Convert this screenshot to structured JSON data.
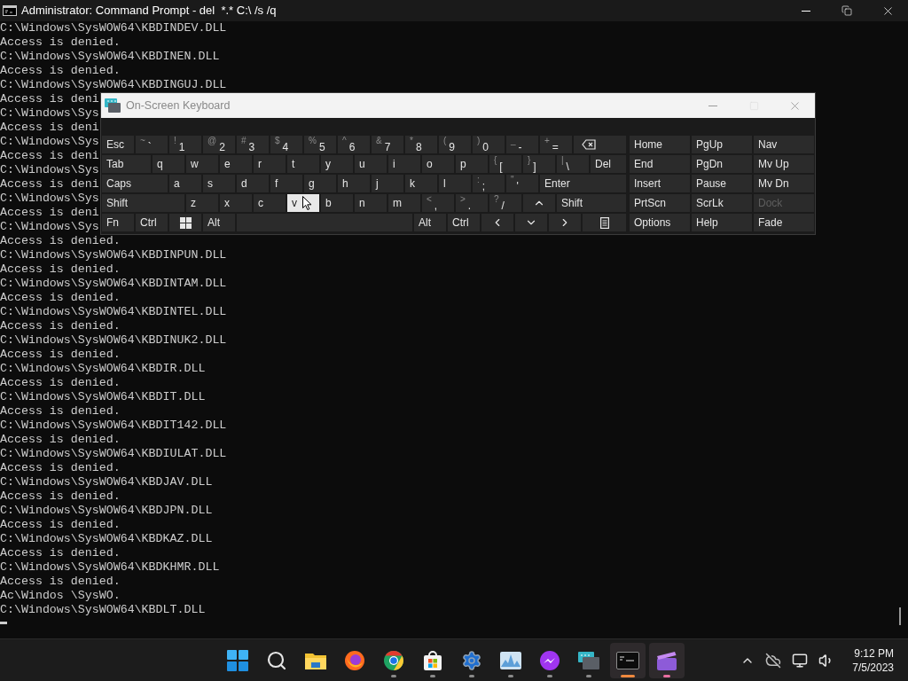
{
  "console": {
    "title": "Administrator: Command Prompt - del  *.* C:\\ /s /q",
    "lines": [
      "C:\\Windows\\SysWOW64\\KBDINDEV.DLL",
      "Access is denied.",
      "C:\\Windows\\SysWOW64\\KBDINEN.DLL",
      "Access is denied.",
      "C:\\Windows\\SysWOW64\\KBDINGUJ.DLL",
      "Access is deni",
      "C:\\Windows\\Sys",
      "Access is deni",
      "C:\\Windows\\Sys",
      "Access is deni",
      "C:\\Windows\\Sys",
      "Access is deni",
      "C:\\Windows\\Sys",
      "Access is deni",
      "C:\\Windows\\Sys",
      "Access is denied.",
      "C:\\Windows\\SysWOW64\\KBDINPUN.DLL",
      "Access is denied.",
      "C:\\Windows\\SysWOW64\\KBDINTAM.DLL",
      "Access is denied.",
      "C:\\Windows\\SysWOW64\\KBDINTEL.DLL",
      "Access is denied.",
      "C:\\Windows\\SysWOW64\\KBDINUK2.DLL",
      "Access is denied.",
      "C:\\Windows\\SysWOW64\\KBDIR.DLL",
      "Access is denied.",
      "C:\\Windows\\SysWOW64\\KBDIT.DLL",
      "Access is denied.",
      "C:\\Windows\\SysWOW64\\KBDIT142.DLL",
      "Access is denied.",
      "C:\\Windows\\SysWOW64\\KBDIULAT.DLL",
      "Access is denied.",
      "C:\\Windows\\SysWOW64\\KBDJAV.DLL",
      "Access is denied.",
      "C:\\Windows\\SysWOW64\\KBDJPN.DLL",
      "Access is denied.",
      "C:\\Windows\\SysWOW64\\KBDKAZ.DLL",
      "Access is denied.",
      "C:\\Windows\\SysWOW64\\KBDKHMR.DLL",
      "Access is denied.",
      "Ac\\Windos \\SysWO.",
      "C:\\Windows\\SysWOW64\\KBDLT.DLL"
    ]
  },
  "keyboard": {
    "title": "On-Screen Keyboard",
    "rows": [
      {
        "keys": [
          {
            "kind": "char",
            "label": "Esc",
            "hovered": false
          },
          {
            "kind": "char",
            "shift": "~",
            "label": "`",
            "hovered": false
          },
          {
            "kind": "char",
            "shift": "!",
            "label": "1",
            "hovered": false
          },
          {
            "kind": "char",
            "shift": "@",
            "label": "2",
            "hovered": false
          },
          {
            "kind": "char",
            "shift": "#",
            "label": "3",
            "hovered": false
          },
          {
            "kind": "char",
            "shift": "$",
            "label": "4",
            "hovered": false
          },
          {
            "kind": "char",
            "shift": "%",
            "label": "5",
            "hovered": false
          },
          {
            "kind": "char",
            "shift": "^",
            "label": "6",
            "hovered": false
          },
          {
            "kind": "char",
            "shift": "&",
            "label": "7",
            "hovered": false
          },
          {
            "kind": "char",
            "shift": "*",
            "label": "8",
            "hovered": false
          },
          {
            "kind": "char",
            "shift": "(",
            "label": "9",
            "hovered": false
          },
          {
            "kind": "char",
            "shift": ")",
            "label": "0",
            "hovered": false
          },
          {
            "kind": "char",
            "shift": "_",
            "label": "-",
            "hovered": false
          },
          {
            "kind": "char",
            "shift": "+",
            "label": "=",
            "hovered": false
          },
          {
            "kind": "backspace",
            "hovered": false
          }
        ]
      },
      {
        "keys": [
          {
            "kind": "tab",
            "label": "Tab",
            "hovered": false
          },
          {
            "kind": "char",
            "label": "q",
            "hovered": false
          },
          {
            "kind": "char",
            "label": "w",
            "hovered": false
          },
          {
            "kind": "char",
            "label": "e",
            "hovered": false
          },
          {
            "kind": "char",
            "label": "r",
            "hovered": false
          },
          {
            "kind": "char",
            "label": "t",
            "hovered": false
          },
          {
            "kind": "char",
            "label": "y",
            "hovered": false
          },
          {
            "kind": "char",
            "label": "u",
            "hovered": false
          },
          {
            "kind": "char",
            "label": "i",
            "hovered": false
          },
          {
            "kind": "char",
            "label": "o",
            "hovered": false
          },
          {
            "kind": "char",
            "label": "p",
            "hovered": false
          },
          {
            "kind": "char",
            "shift": "{",
            "label": "[",
            "hovered": false
          },
          {
            "kind": "char",
            "shift": "}",
            "label": "]",
            "hovered": false
          },
          {
            "kind": "char",
            "shift": "|",
            "label": "\\",
            "hovered": false
          },
          {
            "kind": "wide",
            "label": "Del",
            "hovered": false
          }
        ]
      },
      {
        "keys": [
          {
            "kind": "caps",
            "label": "Caps",
            "hovered": false
          },
          {
            "kind": "char",
            "label": "a",
            "hovered": false
          },
          {
            "kind": "char",
            "label": "s",
            "hovered": false
          },
          {
            "kind": "char",
            "label": "d",
            "hovered": false
          },
          {
            "kind": "char",
            "label": "f",
            "hovered": false
          },
          {
            "kind": "char",
            "label": "g",
            "hovered": false
          },
          {
            "kind": "char",
            "label": "h",
            "hovered": false
          },
          {
            "kind": "char",
            "label": "j",
            "hovered": false
          },
          {
            "kind": "char",
            "label": "k",
            "hovered": false
          },
          {
            "kind": "char",
            "label": "l",
            "hovered": false
          },
          {
            "kind": "char",
            "shift": ":",
            "label": ";",
            "hovered": false
          },
          {
            "kind": "char",
            "shift": "\"",
            "label": "'",
            "hovered": false
          },
          {
            "kind": "wide",
            "label": "Enter",
            "hovered": false
          }
        ]
      },
      {
        "keys": [
          {
            "kind": "shift",
            "label": "Shift",
            "hovered": false
          },
          {
            "kind": "char",
            "label": "z",
            "hovered": false
          },
          {
            "kind": "char",
            "label": "x",
            "hovered": false
          },
          {
            "kind": "char",
            "label": "c",
            "hovered": false
          },
          {
            "kind": "char",
            "label": "v",
            "hovered": true
          },
          {
            "kind": "char",
            "label": "b",
            "hovered": false
          },
          {
            "kind": "char",
            "label": "n",
            "hovered": false
          },
          {
            "kind": "char",
            "label": "m",
            "hovered": false
          },
          {
            "kind": "char",
            "shift": "<",
            "label": ",",
            "hovered": false
          },
          {
            "kind": "char",
            "shift": ">",
            "label": ".",
            "hovered": false
          },
          {
            "kind": "char",
            "shift": "?",
            "label": "/",
            "hovered": false
          },
          {
            "kind": "up",
            "hovered": false
          },
          {
            "kind": "wide",
            "label": "Shift",
            "hovered": false
          }
        ]
      },
      {
        "keys": [
          {
            "kind": "char",
            "label": "Fn",
            "hovered": false
          },
          {
            "kind": "char",
            "label": "Ctrl",
            "hovered": false
          },
          {
            "kind": "windows",
            "hovered": false
          },
          {
            "kind": "char",
            "label": "Alt",
            "hovered": false
          },
          {
            "kind": "space",
            "hovered": false
          },
          {
            "kind": "char",
            "label": "Alt",
            "hovered": false
          },
          {
            "kind": "char",
            "label": "Ctrl",
            "hovered": false
          },
          {
            "kind": "left",
            "hovered": false
          },
          {
            "kind": "down",
            "hovered": false
          },
          {
            "kind": "right",
            "hovered": false
          },
          {
            "kind": "menu",
            "hovered": false
          }
        ]
      }
    ],
    "nav": [
      {
        "label": "Home",
        "disabled": false
      },
      {
        "label": "PgUp",
        "disabled": false
      },
      {
        "label": "Nav",
        "disabled": false
      },
      {
        "label": "End",
        "disabled": false
      },
      {
        "label": "PgDn",
        "disabled": false
      },
      {
        "label": "Mv Up",
        "disabled": false
      },
      {
        "label": "Insert",
        "disabled": false
      },
      {
        "label": "Pause",
        "disabled": false
      },
      {
        "label": "Mv Dn",
        "disabled": false
      },
      {
        "label": "PrtScn",
        "disabled": false
      },
      {
        "label": "ScrLk",
        "disabled": false
      },
      {
        "label": "Dock",
        "disabled": true
      },
      {
        "label": "Options",
        "disabled": false
      },
      {
        "label": "Help",
        "disabled": false
      },
      {
        "label": "Fade",
        "disabled": false
      }
    ]
  },
  "taskbar": {
    "apps": [
      {
        "kind": "start",
        "running": false,
        "active": false
      },
      {
        "kind": "search",
        "running": false,
        "active": false
      },
      {
        "kind": "folder",
        "running": false,
        "active": false
      },
      {
        "kind": "firefox",
        "running": false,
        "active": false
      },
      {
        "kind": "chrome",
        "running": true,
        "active": false
      },
      {
        "kind": "store",
        "running": true,
        "active": false
      },
      {
        "kind": "settings",
        "running": true,
        "active": false
      },
      {
        "kind": "monitor",
        "running": true,
        "active": false
      },
      {
        "kind": "messenger",
        "running": true,
        "active": false
      },
      {
        "kind": "keyboard",
        "running": true,
        "active": false
      },
      {
        "kind": "terminal",
        "running": true,
        "active": true
      },
      {
        "kind": "clip",
        "running": true,
        "active": true
      }
    ],
    "clock": {
      "time": "9:12 PM",
      "date": "7/5/2023"
    }
  }
}
